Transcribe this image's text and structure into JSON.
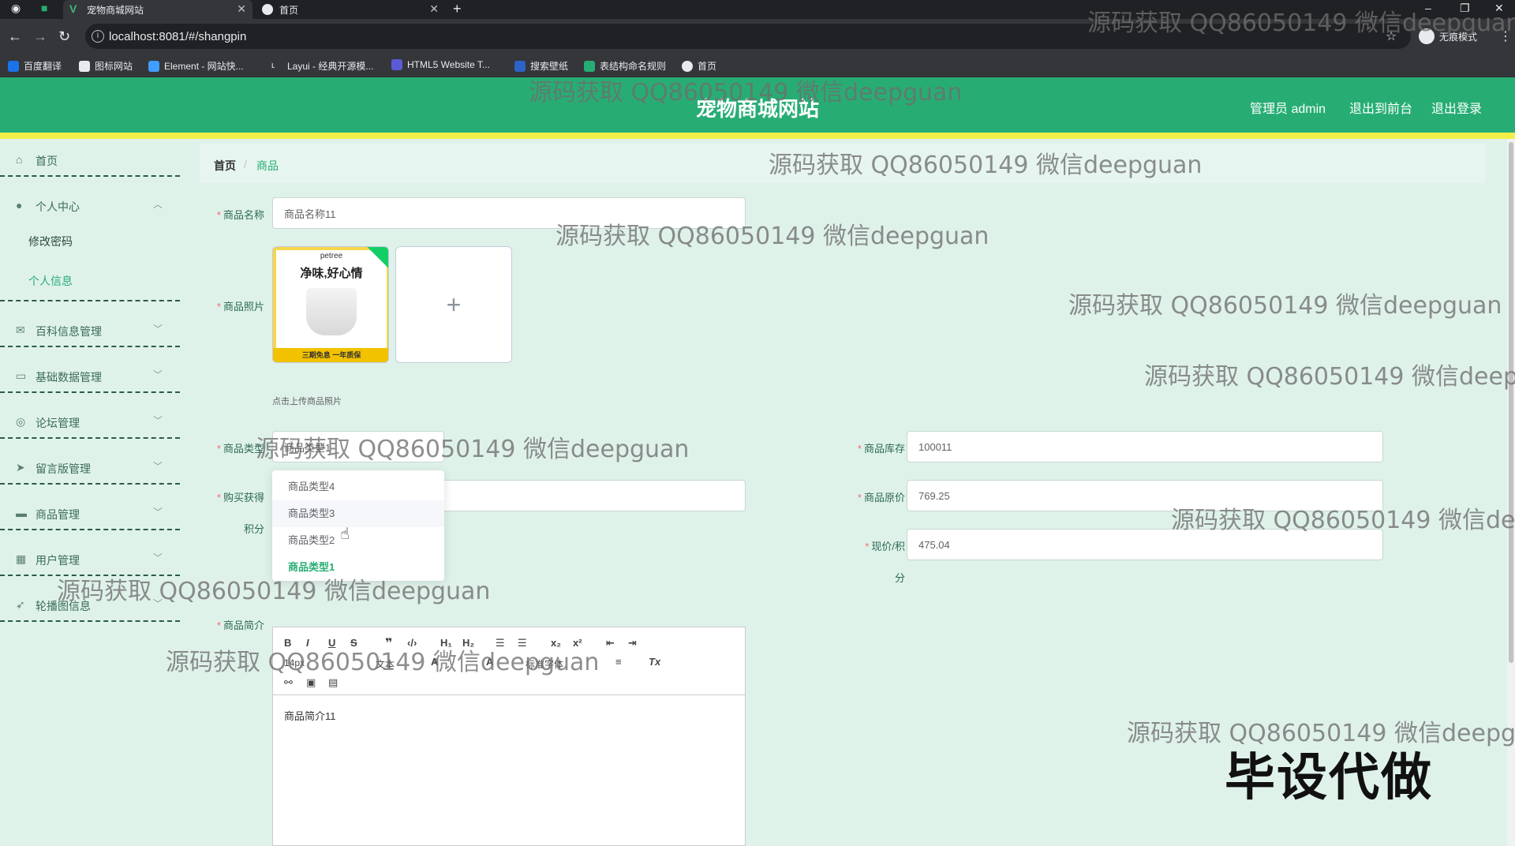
{
  "browser": {
    "tabs": [
      {
        "title": "宠物商城网站",
        "active": true
      },
      {
        "title": "首页",
        "active": false
      }
    ],
    "url": "localhost:8081/#/shangpin",
    "incognito_label": "无痕模式",
    "bookmarks": [
      "百度翻译",
      "图标网站",
      "Element - 网站快...",
      "Layui - 经典开源模...",
      "HTML5 Website T...",
      "搜索壁纸",
      "表结构命名规则",
      "首页"
    ]
  },
  "header": {
    "site_title": "宠物商城网站",
    "admin_label": "管理员 admin",
    "to_front_label": "退出到前台",
    "logout_label": "退出登录",
    "accent": "#27ad74",
    "strip_color": "#f2ef4a"
  },
  "sidebar": {
    "items": [
      {
        "label": "首页",
        "icon": "home-icon"
      },
      {
        "label": "个人中心",
        "icon": "user-icon",
        "children": [
          "修改密码",
          "个人信息"
        ]
      },
      {
        "label": "百科信息管理",
        "icon": "mail-icon"
      },
      {
        "label": "基础数据管理",
        "icon": "chat-icon"
      },
      {
        "label": "论坛管理",
        "icon": "compass-icon"
      },
      {
        "label": "留言版管理",
        "icon": "send-icon"
      },
      {
        "label": "商品管理",
        "icon": "goods-icon"
      },
      {
        "label": "用户管理",
        "icon": "grid-icon"
      },
      {
        "label": "轮播图信息",
        "icon": "location-icon"
      }
    ]
  },
  "breadcrumb": {
    "home": "首页",
    "separator": "/",
    "current": "商品"
  },
  "form": {
    "name_label": "商品名称",
    "name_value": "商品名称11",
    "photo_label": "商品照片",
    "photo_brand": "petree",
    "photo_slogan": "净味,好心情",
    "photo_footer": "三期免息  一年质保",
    "upload_tip": "点击上传商品照片",
    "type_label": "商品类型",
    "type_value": "商品类型1",
    "type_options": [
      "商品类型4",
      "商品类型3",
      "商品类型2",
      "商品类型1"
    ],
    "points_label_1": "购买获得",
    "points_label_2": "积分",
    "stock_label": "商品库存",
    "stock_value": "100011",
    "orig_price_label": "商品原价",
    "orig_price_value": "769.25",
    "now_price_label_1": "现价/积",
    "now_price_label_2": "分",
    "now_price_value": "475.04",
    "intro_label": "商品简介",
    "intro_value": "商品简介11",
    "editor": {
      "size": "14px",
      "font_style": "文本",
      "font_family": "标准字体"
    }
  },
  "watermarks": {
    "text": "源码获取 QQ86050149 微信deepguan",
    "text_top_right": "源码获取 QQ86050149 微信deepguan",
    "cut_text_1": "源码获取 QQ86050149 微信deepg",
    "cut_text_2": "源码获取 QQ86050149 微信dee",
    "cut_text_3": "源码获取 QQ86050149 微信deepgu",
    "stamp": "毕设代做"
  }
}
